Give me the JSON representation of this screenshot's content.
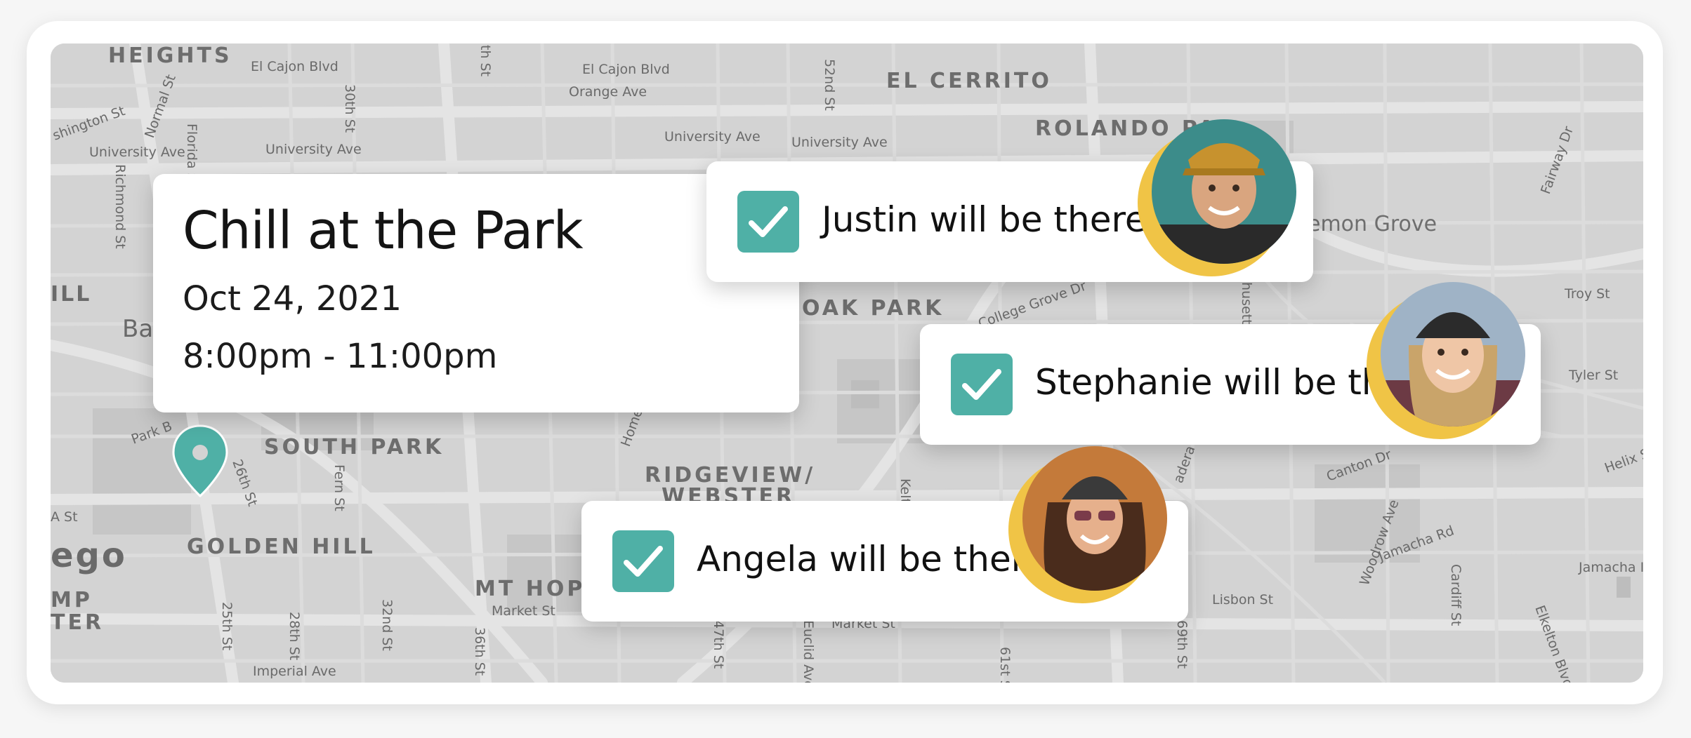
{
  "event": {
    "title": "Chill at the Park",
    "date": "Oct 24, 2021",
    "time": "8:00pm - 11:00pm"
  },
  "rsvps": [
    {
      "name": "Justin",
      "text": "Justin will be there!",
      "checked": true
    },
    {
      "name": "Stephanie",
      "text": "Stephanie will be there!",
      "checked": true
    },
    {
      "name": "Angela",
      "text": "Angela will be there!",
      "checked": true
    }
  ],
  "map": {
    "areas": [
      "HEIGHTS",
      "EL CERRITO",
      "ROLANDO PA",
      "OAK PARK",
      "SOUTH PARK",
      "RIDGEVIEW/",
      "WEBSTER",
      "GOLDEN HILL",
      "MT HOPE",
      "ego",
      "MP",
      "TER",
      "ILL",
      "Ba"
    ],
    "streets": [
      "El Cajon Blvd",
      "El Cajon Blvd",
      "Orange Ave",
      "shington St",
      "University Ave",
      "University Ave",
      "University Ave",
      "University Ave",
      "Normal St",
      "30th St",
      "Florida St",
      "Richmond St",
      "52nd St",
      "College Grove Dr",
      "emon Grove",
      "Troy St",
      "Tyler St",
      "Fairway Dr",
      "Park B",
      "26th St",
      "Fern St",
      "Home",
      "Kelt",
      "adera St",
      "Canton Dr",
      "Helix S",
      "Woodrow Ave",
      "Jamacha Rd",
      "Jamacha I",
      "Cardiff St",
      "Elkelton Blvd",
      "Lisbon St",
      "Market St",
      "Market St",
      "25th St",
      "28th St",
      "32nd St",
      "36th St",
      "47th St",
      "Euclid Ave",
      "61st S",
      "69th St",
      "Imperial Ave",
      "A St",
      "th St",
      "husett"
    ]
  },
  "colors": {
    "accent": "#4fb0a6",
    "ring": "#f0c446",
    "map_bg": "#d3d3d3"
  },
  "icons": [
    "check-icon",
    "map-pin-icon"
  ]
}
